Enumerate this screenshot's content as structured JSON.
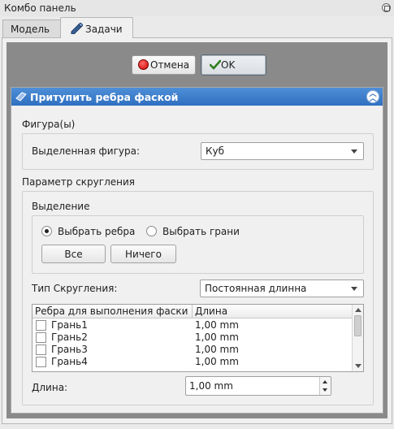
{
  "window": {
    "title": "Комбо панель"
  },
  "tabs": [
    {
      "label": "Модель",
      "active": false
    },
    {
      "label": "Задачи",
      "active": true
    }
  ],
  "dialog_buttons": {
    "cancel": "Отмена",
    "ok": "OK"
  },
  "taskbox": {
    "title": "Притупить ребра фаской",
    "shapes_group": {
      "title": "Фигура(ы)",
      "selected_shape_label": "Выделенная фигура:",
      "selected_shape_value": "Куб"
    },
    "fillet_params": {
      "title": "Параметр скругления",
      "selection_group": {
        "title": "Выделение",
        "radio_edges": "Выбрать ребра",
        "radio_faces": "Выбрать грани",
        "selected_radio": "edges",
        "btn_all": "Все",
        "btn_none": "Ничего"
      },
      "fillet_type_label": "Тип Скругления:",
      "fillet_type_value": "Постоянная длинна",
      "table": {
        "headers": [
          "Ребра для выполнения фаски",
          "Длина"
        ],
        "rows": [
          {
            "name": "Грань1",
            "length": "1,00 mm",
            "checked": false
          },
          {
            "name": "Грань2",
            "length": "1,00 mm",
            "checked": false
          },
          {
            "name": "Грань3",
            "length": "1,00 mm",
            "checked": false
          },
          {
            "name": "Грань4",
            "length": "1,00 mm",
            "checked": false
          }
        ]
      },
      "length_label": "Длина:",
      "length_value": "1,00 mm"
    }
  },
  "colors": {
    "header_blue": "#3a7bd0",
    "content_bg": "#8a8a8a",
    "panel_bg": "#f0f0f0"
  }
}
